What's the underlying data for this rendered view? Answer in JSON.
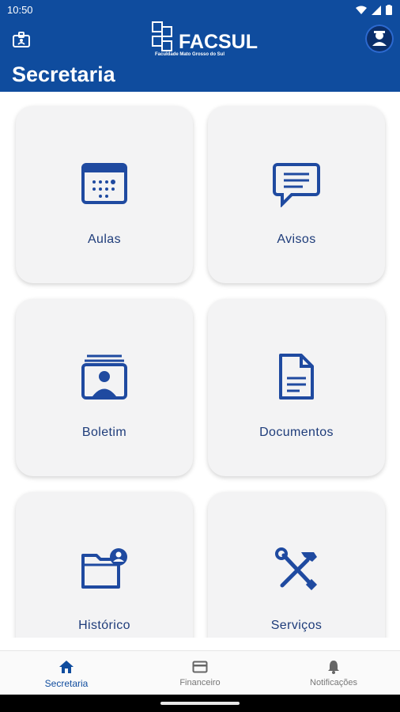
{
  "status_bar": {
    "time": "10:50"
  },
  "header": {
    "logo_text": "FACSUL",
    "logo_subtitle": "Faculdade Mato Grosso do Sul",
    "title": "Secretaria"
  },
  "cards": [
    {
      "label": "Aulas",
      "icon": "calendar-icon"
    },
    {
      "label": "Avisos",
      "icon": "message-icon"
    },
    {
      "label": "Boletim",
      "icon": "id-card-icon"
    },
    {
      "label": "Documentos",
      "icon": "document-icon"
    },
    {
      "label": "Histórico",
      "icon": "folder-user-icon"
    },
    {
      "label": "Serviços",
      "icon": "tools-icon"
    }
  ],
  "bottom_nav": [
    {
      "label": "Secretaria",
      "icon": "home-icon",
      "active": true
    },
    {
      "label": "Financeiro",
      "icon": "card-icon",
      "active": false
    },
    {
      "label": "Notificações",
      "icon": "bell-icon",
      "active": false
    }
  ],
  "colors": {
    "primary": "#0f4c9e",
    "card_bg": "#f3f3f4",
    "label": "#1e3c7a"
  }
}
